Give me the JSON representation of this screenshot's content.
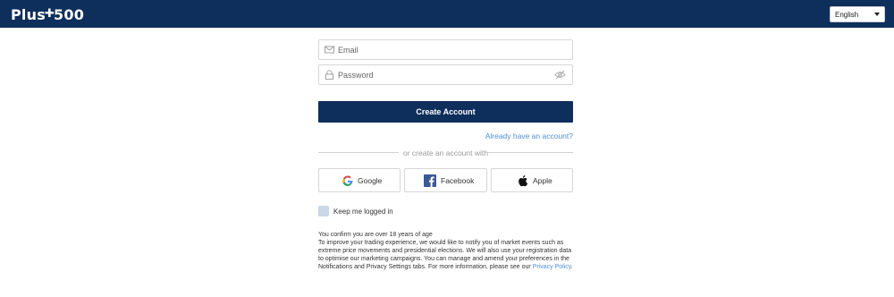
{
  "header": {
    "logo_text_left": "Plus",
    "logo_plus": "✚",
    "logo_text_right": "500",
    "language": "English"
  },
  "form": {
    "email_placeholder": "Email",
    "password_placeholder": "Password",
    "create_label": "Create Account",
    "already_link": "Already have an account?",
    "divider_text": "or create an account with"
  },
  "social": {
    "google_label": "Google",
    "facebook_label": "Facebook",
    "apple_label": "Apple"
  },
  "keep_logged_in_label": "Keep me logged in",
  "legal": {
    "age_line": "You confirm you are over 18 years of age",
    "notify_text": "To improve your trading experience, we would like to notify you of market events such as extreme price movements and presidential elections. We will also use your registration data to optimise our marketing campaigns. You can manage and amend your preferences in the Notifications and Privacy Settings tabs. For more information, please see our",
    "privacy_link": "Privacy Policy",
    "end_period": "."
  },
  "colors": {
    "brand_navy": "#0e2f5c",
    "link_blue": "#4d8fd6",
    "checkbox_fill": "#c9d7e6"
  },
  "icons": [
    "mail-icon",
    "lock-icon",
    "eye-slash-icon",
    "google-icon",
    "facebook-icon",
    "apple-icon",
    "caret-down-icon"
  ]
}
